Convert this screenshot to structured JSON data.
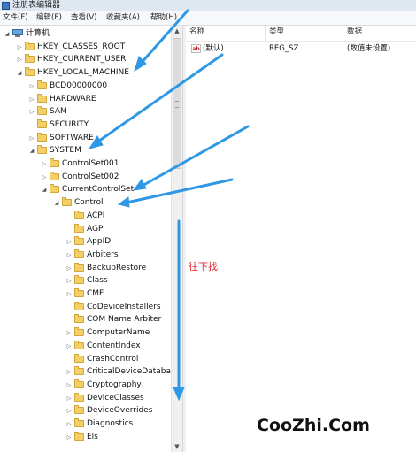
{
  "window": {
    "title": "注册表编辑器"
  },
  "menu": [
    "文件(F)",
    "编辑(E)",
    "查看(V)",
    "收藏夹(A)",
    "帮助(H)"
  ],
  "tree": [
    {
      "label": "计算机",
      "level": 0,
      "expander": "open",
      "icon": "computer-icon"
    },
    {
      "label": "HKEY_CLASSES_ROOT",
      "level": 1,
      "expander": "closed"
    },
    {
      "label": "HKEY_CURRENT_USER",
      "level": 1,
      "expander": "closed"
    },
    {
      "label": "HKEY_LOCAL_MACHINE",
      "level": 1,
      "expander": "open"
    },
    {
      "label": "BCD00000000",
      "level": 2,
      "expander": "closed"
    },
    {
      "label": "HARDWARE",
      "level": 2,
      "expander": "closed"
    },
    {
      "label": "SAM",
      "level": 2,
      "expander": "closed"
    },
    {
      "label": "SECURITY",
      "level": 2,
      "expander": "none"
    },
    {
      "label": "SOFTWARE",
      "level": 2,
      "expander": "closed"
    },
    {
      "label": "SYSTEM",
      "level": 2,
      "expander": "open"
    },
    {
      "label": "ControlSet001",
      "level": 3,
      "expander": "closed"
    },
    {
      "label": "ControlSet002",
      "level": 3,
      "expander": "closed"
    },
    {
      "label": "CurrentControlSet",
      "level": 3,
      "expander": "open"
    },
    {
      "label": "Control",
      "level": 4,
      "expander": "open"
    },
    {
      "label": "ACPI",
      "level": 5,
      "expander": "none"
    },
    {
      "label": "AGP",
      "level": 5,
      "expander": "none"
    },
    {
      "label": "AppID",
      "level": 5,
      "expander": "closed"
    },
    {
      "label": "Arbiters",
      "level": 5,
      "expander": "closed"
    },
    {
      "label": "BackupRestore",
      "level": 5,
      "expander": "closed"
    },
    {
      "label": "Class",
      "level": 5,
      "expander": "closed"
    },
    {
      "label": "CMF",
      "level": 5,
      "expander": "closed"
    },
    {
      "label": "CoDeviceInstallers",
      "level": 5,
      "expander": "none"
    },
    {
      "label": "COM Name Arbiter",
      "level": 5,
      "expander": "none"
    },
    {
      "label": "ComputerName",
      "level": 5,
      "expander": "closed"
    },
    {
      "label": "ContentIndex",
      "level": 5,
      "expander": "closed"
    },
    {
      "label": "CrashControl",
      "level": 5,
      "expander": "none"
    },
    {
      "label": "CriticalDeviceDatabas",
      "level": 5,
      "expander": "closed"
    },
    {
      "label": "Cryptography",
      "level": 5,
      "expander": "closed"
    },
    {
      "label": "DeviceClasses",
      "level": 5,
      "expander": "closed"
    },
    {
      "label": "DeviceOverrides",
      "level": 5,
      "expander": "closed"
    },
    {
      "label": "Diagnostics",
      "level": 5,
      "expander": "closed"
    },
    {
      "label": "Els",
      "level": 5,
      "expander": "closed"
    }
  ],
  "columns": [
    "名称",
    "类型",
    "数据"
  ],
  "values": [
    {
      "name": "(默认)",
      "type": "REG_SZ",
      "data": "(数值未设置)"
    }
  ],
  "annotation": "往下找",
  "watermark": "CooZhi.Com",
  "colors": {
    "arrow": "#2f98e4",
    "annotation": "#e8262f",
    "folder": "#f3d067"
  }
}
